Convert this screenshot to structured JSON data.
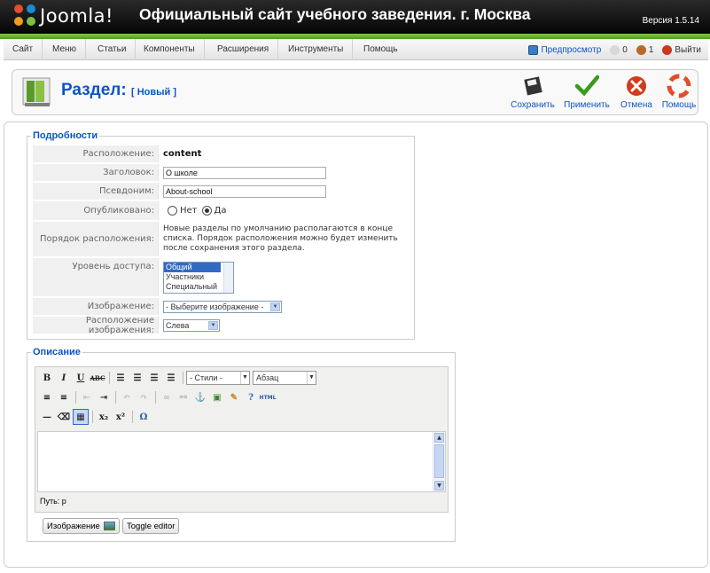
{
  "header": {
    "logo_text": "Joomla!",
    "site_title": "Официальный сайт учебного заведения. г. Москва",
    "version": "Версия 1.5.14"
  },
  "menu": {
    "items": [
      "Сайт",
      "Меню",
      "Статьи",
      "Компоненты",
      "Расширения",
      "Инструменты",
      "Помощь"
    ]
  },
  "status": {
    "preview_label": "Предпросмотр",
    "messages_count": "0",
    "users_count": "1",
    "logout_label": "Выйти"
  },
  "toolbar": {
    "title": "Раздел:",
    "subtitle": "[ Новый ]",
    "save": "Сохранить",
    "apply": "Применить",
    "cancel": "Отмена",
    "help": "Помощь"
  },
  "details": {
    "legend": "Подробности",
    "location_label": "Расположение:",
    "location_value": "content",
    "title_label": "Заголовок:",
    "title_value": "О школе",
    "alias_label": "Псевдоним:",
    "alias_value": "About-school",
    "published_label": "Опубликовано:",
    "published_no": "Нет",
    "published_yes": "Да",
    "order_label": "Порядок расположения:",
    "order_text": "Новые разделы по умолчанию располагаются в конце списка. Порядок расположения можно будет изменить после сохранения этого раздела.",
    "access_label": "Уровень доступа:",
    "access_options": [
      "Общий",
      "Участники",
      "Специальный"
    ],
    "access_selected": "Общий",
    "image_label": "Изображение:",
    "image_value": "- Выберите изображение -",
    "image_pos_label": "Расположение изображения:",
    "image_pos_value": "Слева"
  },
  "description": {
    "legend": "Описание",
    "styles_select": "- Стили -",
    "format_select": "Абзац",
    "path_label": "Путь: p",
    "image_button": "Изображение",
    "toggle_button": "Toggle editor"
  },
  "colors": {
    "header_bg": "#0a0a0a",
    "accent_green": "#5aad2a",
    "link_blue": "#0b55c4"
  }
}
